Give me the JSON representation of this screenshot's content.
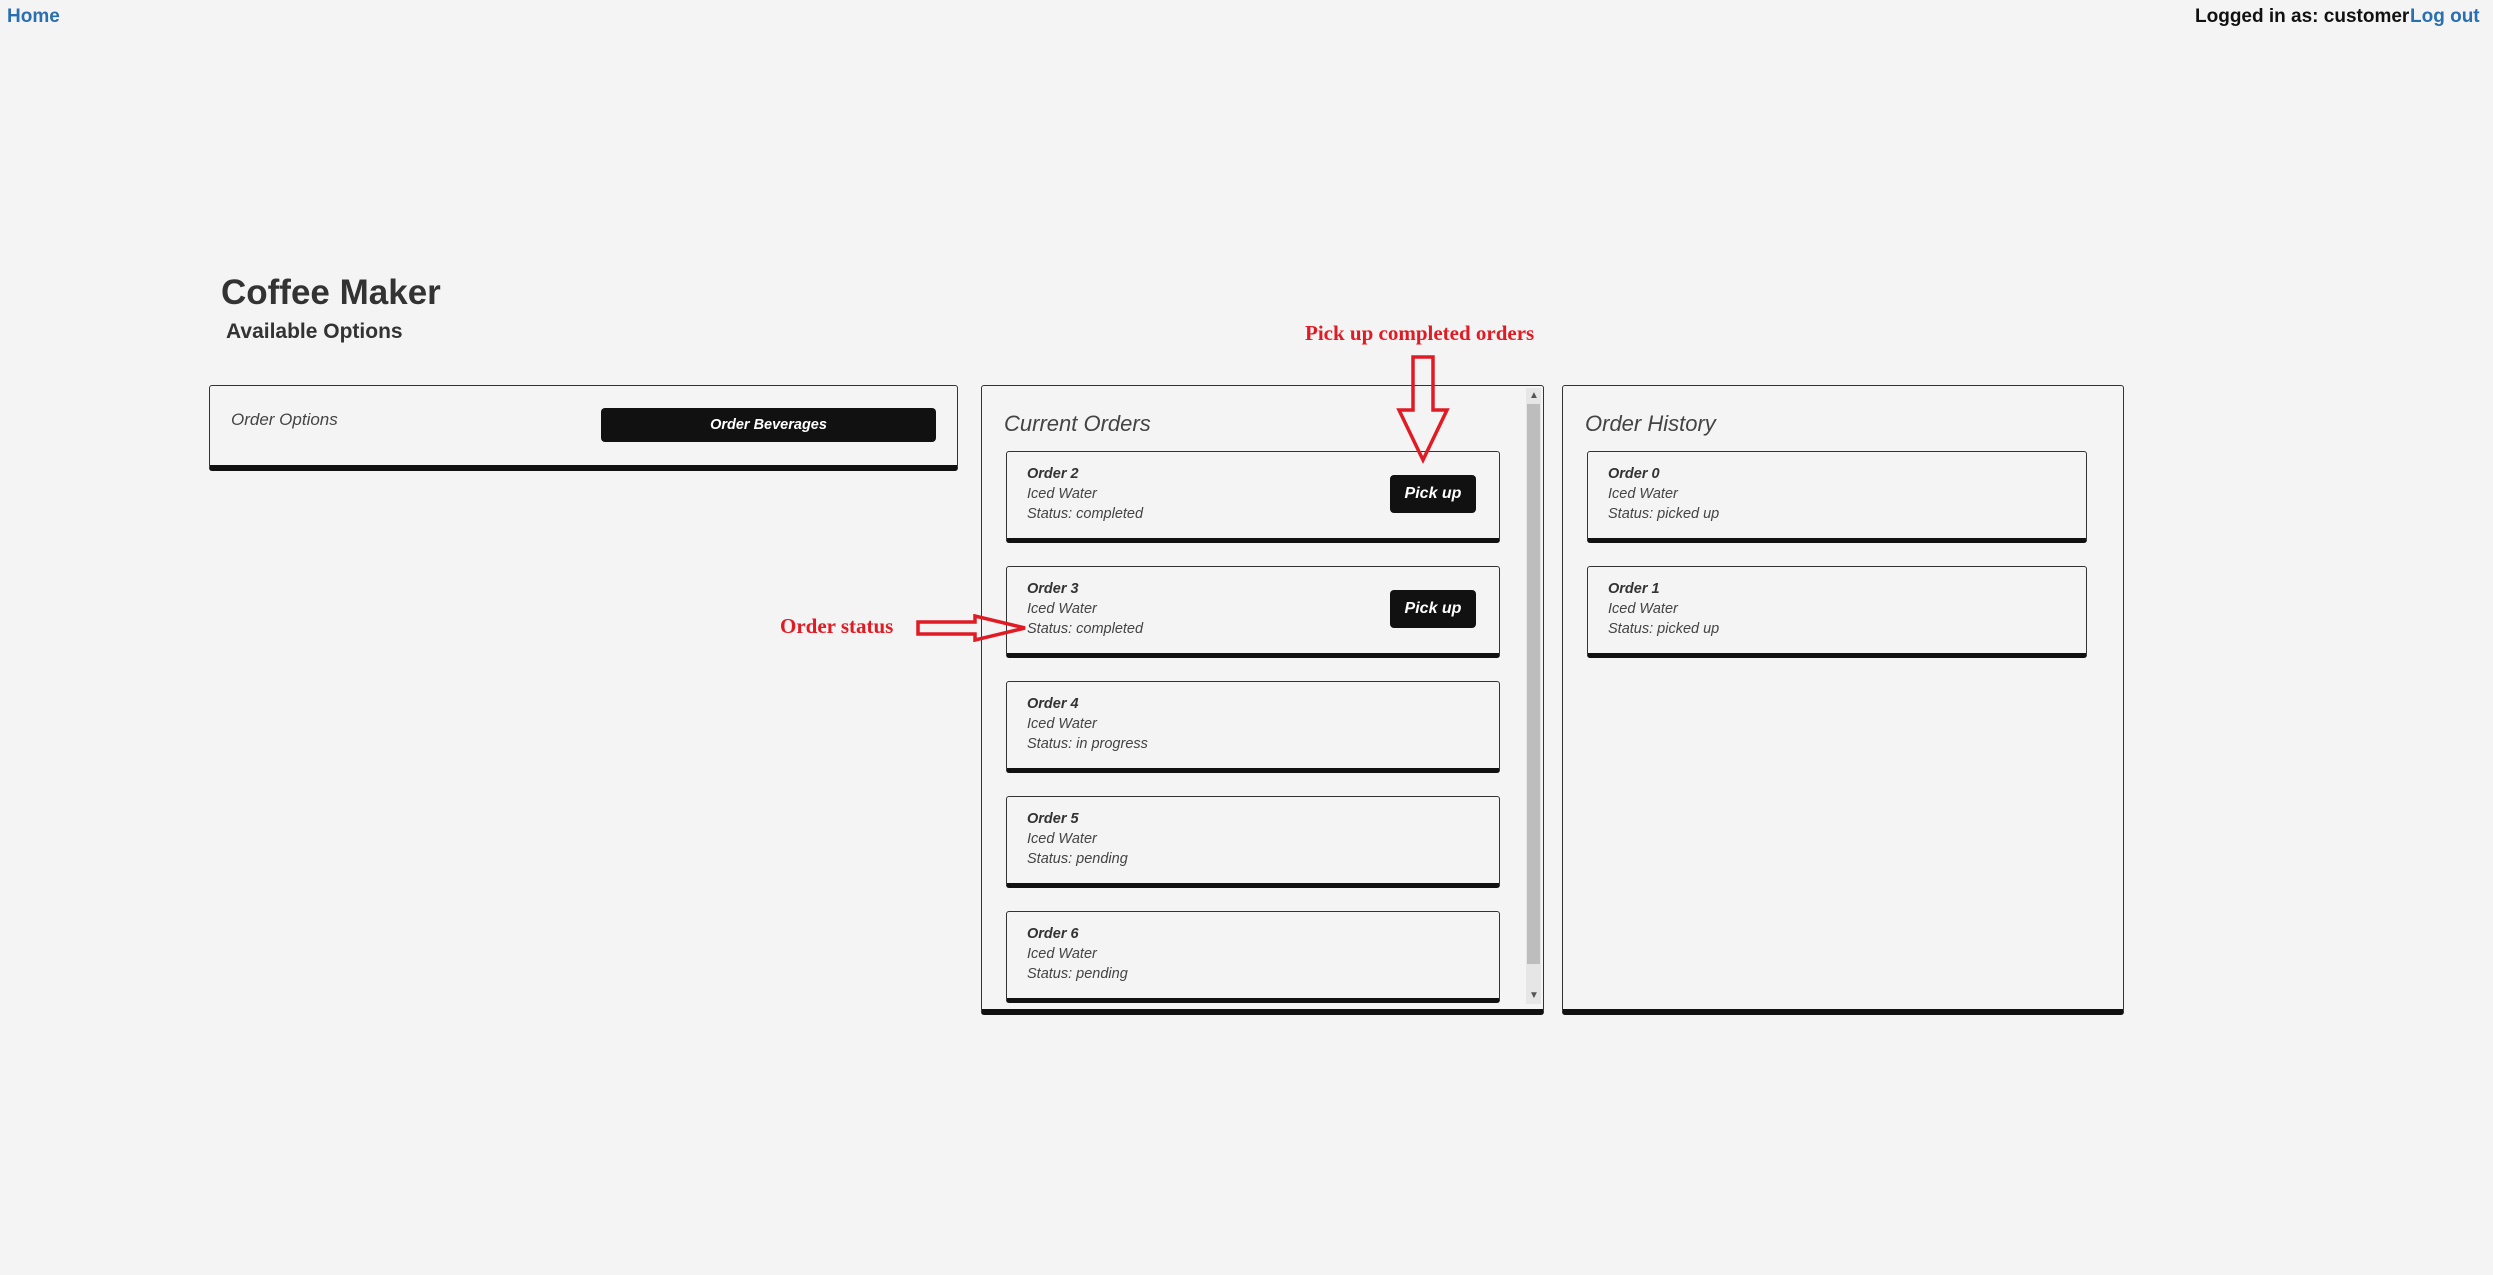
{
  "nav": {
    "home": "Home",
    "logged_in": "Logged in as: customer",
    "logout": "Log out"
  },
  "app": {
    "title": "Coffee Maker",
    "subtitle": "Available Options"
  },
  "order_options": {
    "label": "Order Options",
    "button": "Order Beverages"
  },
  "current_orders": {
    "title": "Current Orders",
    "pickup_label": "Pick up",
    "orders": [
      {
        "title": "Order 2",
        "item": "Iced Water",
        "status": "Status: completed",
        "pickup": true
      },
      {
        "title": "Order 3",
        "item": "Iced Water",
        "status": "Status: completed",
        "pickup": true
      },
      {
        "title": "Order 4",
        "item": "Iced Water",
        "status": "Status: in progress",
        "pickup": false
      },
      {
        "title": "Order 5",
        "item": "Iced Water",
        "status": "Status: pending",
        "pickup": false
      },
      {
        "title": "Order 6",
        "item": "Iced Water",
        "status": "Status: pending",
        "pickup": false
      }
    ]
  },
  "order_history": {
    "title": "Order History",
    "orders": [
      {
        "title": "Order 0",
        "item": "Iced Water",
        "status": "Status: picked up"
      },
      {
        "title": "Order 1",
        "item": "Iced Water",
        "status": "Status: picked up"
      }
    ]
  },
  "annotations": {
    "pickup_note": "Pick up completed orders",
    "status_note": "Order status",
    "color": "#e01b24"
  }
}
